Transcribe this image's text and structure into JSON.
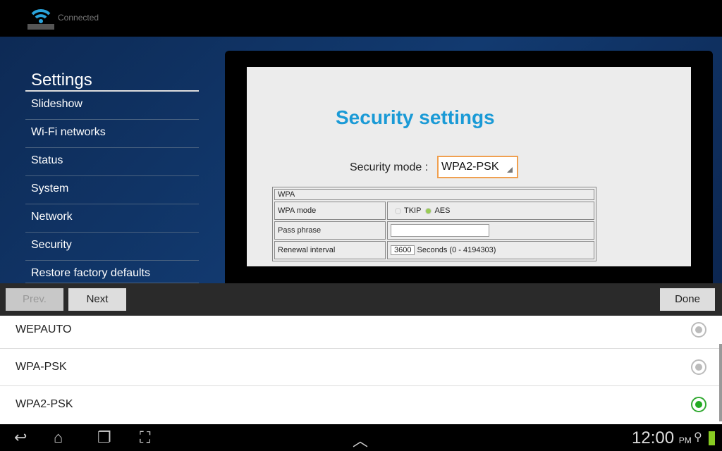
{
  "status": {
    "connection": "Connected"
  },
  "sidebar": {
    "title": "Settings",
    "items": [
      {
        "label": "Slideshow"
      },
      {
        "label": "Wi-Fi networks"
      },
      {
        "label": "Status"
      },
      {
        "label": "System"
      },
      {
        "label": "Network"
      },
      {
        "label": "Security"
      },
      {
        "label": "Restore factory defaults"
      }
    ]
  },
  "web": {
    "title": "Security settings",
    "mode_label": "Security mode :",
    "mode_value": "WPA2-PSK",
    "table": {
      "header": "WPA",
      "wpa_mode_label": "WPA mode",
      "opt_tkip": "TKIP",
      "opt_aes": "AES",
      "selected": "AES",
      "pass_label": "Pass phrase",
      "pass_value": "",
      "renewal_label": "Renewal interval",
      "renewal_value": "3600",
      "renewal_hint": "Seconds (0 - 4194303)"
    }
  },
  "toolbar": {
    "prev": "Prev.",
    "next": "Next",
    "done": "Done"
  },
  "options": [
    {
      "label": "WEPAUTO",
      "selected": false
    },
    {
      "label": "WPA-PSK",
      "selected": false
    },
    {
      "label": "WPA2-PSK",
      "selected": true
    }
  ],
  "navbar": {
    "time": "12:00",
    "ampm": "PM"
  },
  "colors": {
    "accent": "#1a9ad6",
    "selected_radio": "#22aa22",
    "battery": "#88cc22"
  }
}
